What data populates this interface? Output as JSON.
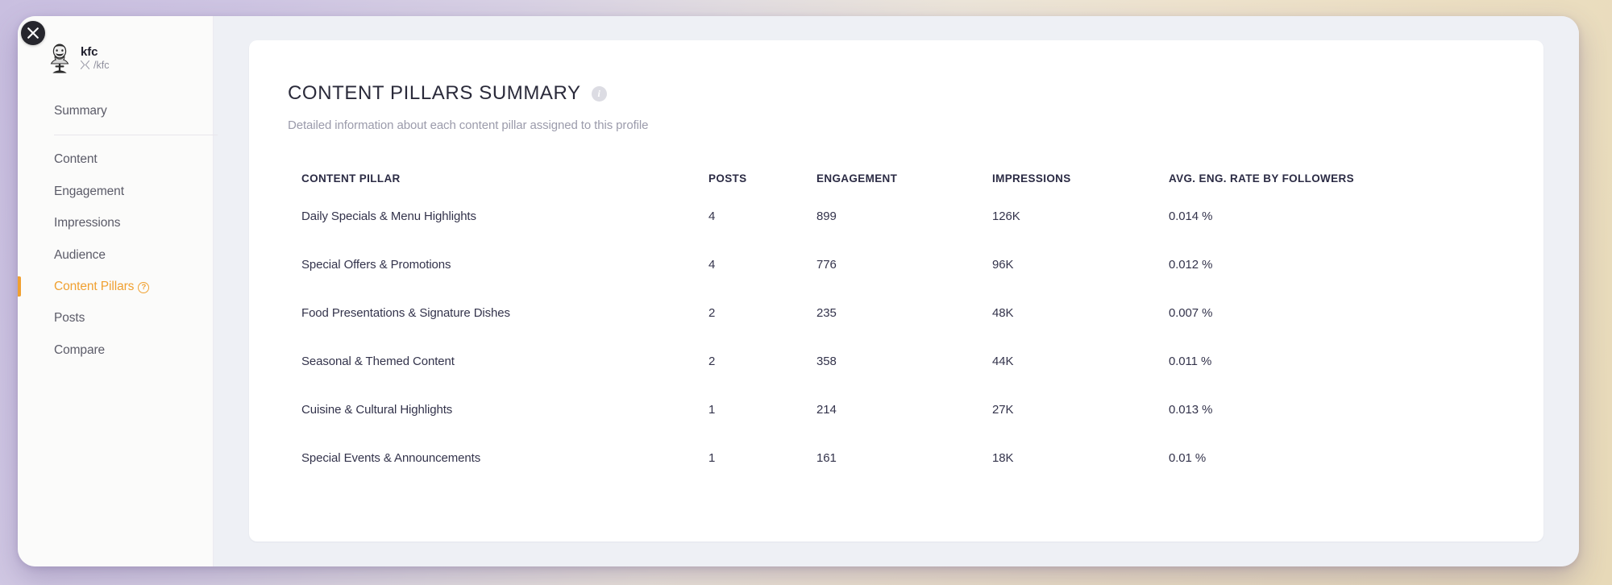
{
  "window": {
    "close_label": "X"
  },
  "sidebar": {
    "profile": {
      "name": "kfc",
      "handle": "/kfc",
      "network_icon": "x-icon",
      "avatar_icon": "kfc-colonel-avatar"
    },
    "items": [
      {
        "label": "Summary",
        "active": false
      },
      {
        "label": "Content",
        "active": false
      },
      {
        "label": "Engagement",
        "active": false
      },
      {
        "label": "Impressions",
        "active": false
      },
      {
        "label": "Audience",
        "active": false
      },
      {
        "label": "Content Pillars",
        "active": true,
        "badge": "?"
      },
      {
        "label": "Posts",
        "active": false
      },
      {
        "label": "Compare",
        "active": false
      }
    ],
    "accent_color": "#f0a030"
  },
  "main": {
    "card": {
      "title": "CONTENT PILLARS SUMMARY",
      "info_icon": "info-icon",
      "info_glyph": "i",
      "subtitle": "Detailed information about each content pillar assigned to this profile",
      "table": {
        "columns": [
          "CONTENT PILLAR",
          "POSTS",
          "ENGAGEMENT",
          "IMPRESSIONS",
          "AVG. ENG. RATE BY FOLLOWERS"
        ],
        "rows": [
          {
            "pillar": "Daily Specials & Menu Highlights",
            "posts": "4",
            "engagement": "899",
            "impressions": "126K",
            "rate": "0.014 %"
          },
          {
            "pillar": "Special Offers & Promotions",
            "posts": "4",
            "engagement": "776",
            "impressions": "96K",
            "rate": "0.012 %"
          },
          {
            "pillar": "Food Presentations & Signature Dishes",
            "posts": "2",
            "engagement": "235",
            "impressions": "48K",
            "rate": "0.007 %"
          },
          {
            "pillar": "Seasonal & Themed Content",
            "posts": "2",
            "engagement": "358",
            "impressions": "44K",
            "rate": "0.011 %"
          },
          {
            "pillar": "Cuisine & Cultural Highlights",
            "posts": "1",
            "engagement": "214",
            "impressions": "27K",
            "rate": "0.013 %"
          },
          {
            "pillar": "Special Events & Announcements",
            "posts": "1",
            "engagement": "161",
            "impressions": "18K",
            "rate": "0.01 %"
          }
        ]
      }
    }
  }
}
